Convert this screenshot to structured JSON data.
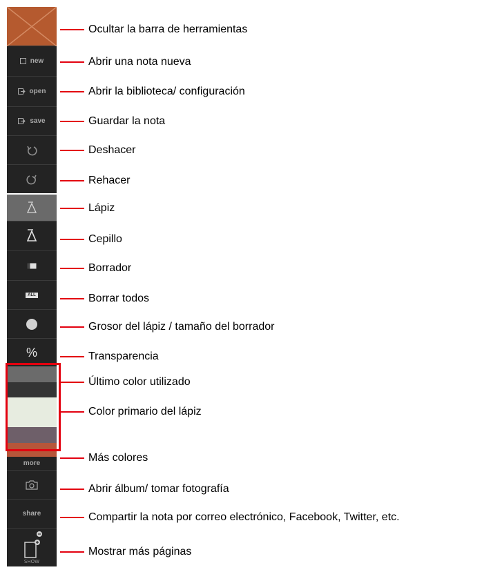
{
  "toolbar": {
    "new_label": "new",
    "open_label": "open",
    "save_label": "save",
    "all_label": "ALL",
    "percent_label": "%",
    "more_label": "more",
    "share_label": "share",
    "show_label": "SHOW"
  },
  "swatches": {
    "last_color_1": "#6b6b6b",
    "last_color_2": "#343434",
    "primary_color": "#e7ece0",
    "palette_1": "#6e5f69",
    "palette_2": "#b6563a"
  },
  "annotations": [
    "Ocultar la barra de herramientas",
    "Abrir una nota nueva",
    "Abrir la biblioteca/ configuración",
    "Guardar la nota",
    "Deshacer",
    "Rehacer",
    "Lápiz",
    "Cepillo",
    "Borrador",
    "Borrar todos",
    "Grosor del lápiz / tamaño del borrador",
    "Transparencia",
    "Último color utilizado",
    "Color primario del lápiz",
    "Más colores",
    "Abrir álbum/ tomar fotografía",
    "Compartir la nota por correo electrónico, Facebook, Twitter, etc.",
    "Mostrar más páginas"
  ],
  "colors": {
    "callout": "#e3000f",
    "toolbar_bg": "#232323",
    "accent": "#b55a2f"
  }
}
